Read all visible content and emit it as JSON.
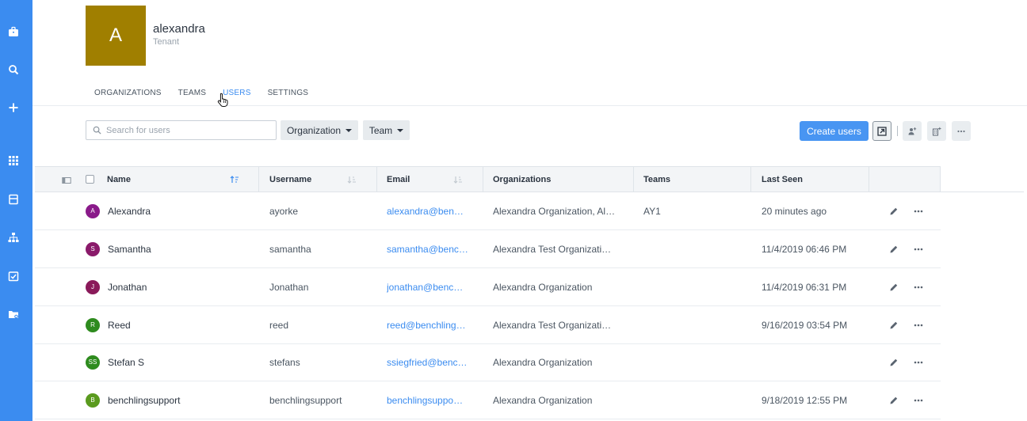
{
  "tenant": {
    "initial": "A",
    "name": "alexandra",
    "type": "Tenant"
  },
  "tabs": [
    {
      "label": "ORGANIZATIONS"
    },
    {
      "label": "TEAMS"
    },
    {
      "label": "USERS"
    },
    {
      "label": "SETTINGS"
    }
  ],
  "active_tab": "USERS",
  "toolbar": {
    "search_placeholder": "Search for users",
    "organization_filter": "Organization",
    "team_filter": "Team",
    "create_label": "Create users"
  },
  "table": {
    "columns": [
      "Name",
      "Username",
      "Email",
      "Organizations",
      "Teams",
      "Last Seen"
    ],
    "rows": [
      {
        "initials": "A",
        "avatar_color": "#8a1a8a",
        "name": "Alexandra",
        "username": "ayorke",
        "email": "alexandra@ben…",
        "organizations": "Alexandra Organization, Al…",
        "teams": "AY1",
        "last_seen": "20 minutes ago"
      },
      {
        "initials": "S",
        "avatar_color": "#8a1a6a",
        "name": "Samantha",
        "username": "samantha",
        "email": "samantha@benc…",
        "organizations": "Alexandra Test Organizati…",
        "teams": "",
        "last_seen": "11/4/2019 06:46 PM"
      },
      {
        "initials": "J",
        "avatar_color": "#8a1a5a",
        "name": "Jonathan",
        "username": "Jonathan",
        "email": "jonathan@benc…",
        "organizations": "Alexandra Organization",
        "teams": "",
        "last_seen": "11/4/2019 06:31 PM"
      },
      {
        "initials": "R",
        "avatar_color": "#2e8b1e",
        "name": "Reed",
        "username": "reed",
        "email": "reed@benchling…",
        "organizations": "Alexandra Test Organizati…",
        "teams": "",
        "last_seen": "9/16/2019 03:54 PM"
      },
      {
        "initials": "SS",
        "avatar_color": "#2e8b1e",
        "name": "Stefan S",
        "username": "stefans",
        "email": "ssiegfried@benc…",
        "organizations": "Alexandra Organization",
        "teams": "",
        "last_seen": ""
      },
      {
        "initials": "B",
        "avatar_color": "#5a9a1e",
        "name": "benchlingsupport",
        "username": "benchlingsupport",
        "email": "benchlingsuppo…",
        "organizations": "Alexandra Organization",
        "teams": "",
        "last_seen": "9/18/2019 12:55 PM"
      }
    ]
  },
  "colors": {
    "rail": "#3b8cf0",
    "accent": "#4895f2",
    "tenant_avatar": "#a07f00"
  },
  "icons": {
    "rail": [
      "briefcase-icon",
      "search-icon",
      "plus-icon",
      "apps-grid-icon",
      "inbox-icon",
      "hierarchy-icon",
      "checklist-icon",
      "folder-icon"
    ],
    "toolbar": [
      "export-icon",
      "add-team-icon",
      "add-org-icon",
      "more-icon"
    ]
  }
}
